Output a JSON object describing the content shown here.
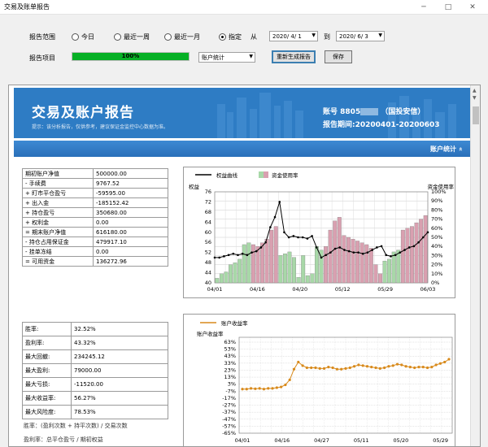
{
  "window": {
    "title": "交易及账单报告",
    "min_icon": "minimize-icon",
    "max_icon": "maximize-icon",
    "close_icon": "close-icon"
  },
  "controls": {
    "range_label": "报告范围",
    "radio_today": "今日",
    "radio_week": "最近一周",
    "radio_month": "最近一月",
    "radio_custom": "指定",
    "selected_range": "指定",
    "from_label": "从",
    "date_from": "2020/ 4/ 1",
    "to_label": "到",
    "date_to": "2020/ 6/ 3",
    "project_label": "报告项目",
    "progress_text": "100%",
    "progress_value": 1.0,
    "progress_color": "#06b025",
    "item_select": "账户统计",
    "regen_button": "重新生成报告",
    "save_button": "保存"
  },
  "report": {
    "title": "交易及账户报告",
    "subtitle": "提示：该分析报告，仅供参考，建议保证金监控中心数据为准。",
    "account_label": "账号",
    "account_prefix": "8805",
    "account_suffix": "（国投安信）",
    "period_label": "报告期间",
    "period_value": "20200401-20200603",
    "section_title": "账户统计",
    "section_toggle": "«"
  },
  "stats1": [
    {
      "label": "期初账户净值",
      "value": "500000.00"
    },
    {
      "label": "- 手续费",
      "value": "9767.52"
    },
    {
      "label": "+ 盯市平仓盈亏",
      "value": "-59595.00"
    },
    {
      "label": "+ 出入金",
      "value": "-185152.42"
    },
    {
      "label": "+ 持仓盈亏",
      "value": "350680.00"
    },
    {
      "label": "+ 权利金",
      "value": "0.00"
    },
    {
      "label": "= 期末账户净值",
      "value": "616180.00"
    },
    {
      "label": "- 持仓占用保证金",
      "value": "479917.10"
    },
    {
      "label": "- 挂单冻结",
      "value": "0.00"
    },
    {
      "label": "= 可用资金",
      "value": "136272.96"
    }
  ],
  "stats2": [
    {
      "label": "胜率:",
      "value": "32.52%"
    },
    {
      "label": "盈利率:",
      "value": "43.32%"
    },
    {
      "label": "最大回撤:",
      "value": "234245.12"
    },
    {
      "label": "最大盈利:",
      "value": "79000.00"
    },
    {
      "label": "最大亏损:",
      "value": "-11520.00"
    },
    {
      "label": "最大收益率:",
      "value": "56.27%"
    },
    {
      "label": "最大风险度:",
      "value": "78.53%"
    }
  ],
  "notes": {
    "win_rate": "胜率：(盈利次数 + 持平次数) / 交易次数",
    "profit_rate": "盈利率：总平仓盈亏 / 期初权益"
  },
  "chart_data": [
    {
      "type": "bar",
      "legend_line": "权益曲线",
      "legend_bar": "资金使用率",
      "ylabel_left": "权益",
      "ylabel_right": "资金使用率",
      "left_ticks": [
        "76",
        "72",
        "68",
        "64",
        "60",
        "56",
        "52",
        "48",
        "44",
        "40"
      ],
      "right_ticks": [
        "100%",
        "90%",
        "80%",
        "70%",
        "60%",
        "50%",
        "40%",
        "30%",
        "20%",
        "10%",
        "0%"
      ],
      "x_ticks": [
        "04/01",
        "04/16",
        "04/20",
        "05/12",
        "05/29",
        "06/03"
      ],
      "ylim_left": [
        40,
        76
      ],
      "ylim_right": [
        0,
        100
      ],
      "bar_colors": {
        "green": "#a8d8a8",
        "pink": "#d9a0b0"
      },
      "usage": [
        {
          "v": 5,
          "c": "green"
        },
        {
          "v": 10,
          "c": "green"
        },
        {
          "v": 12,
          "c": "green"
        },
        {
          "v": 20,
          "c": "green"
        },
        {
          "v": 22,
          "c": "green"
        },
        {
          "v": 26,
          "c": "green"
        },
        {
          "v": 42,
          "c": "green"
        },
        {
          "v": 44,
          "c": "green"
        },
        {
          "v": 42,
          "c": "pink"
        },
        {
          "v": 40,
          "c": "pink"
        },
        {
          "v": 44,
          "c": "pink"
        },
        {
          "v": 48,
          "c": "pink"
        },
        {
          "v": 58,
          "c": "pink"
        },
        {
          "v": 62,
          "c": "pink"
        },
        {
          "v": 30,
          "c": "green"
        },
        {
          "v": 32,
          "c": "green"
        },
        {
          "v": 34,
          "c": "green"
        },
        {
          "v": 28,
          "c": "green"
        },
        {
          "v": 6,
          "c": "green"
        },
        {
          "v": 30,
          "c": "green"
        },
        {
          "v": 8,
          "c": "green"
        },
        {
          "v": 10,
          "c": "green"
        },
        {
          "v": 40,
          "c": "green"
        },
        {
          "v": 36,
          "c": "green"
        },
        {
          "v": 40,
          "c": "pink"
        },
        {
          "v": 58,
          "c": "pink"
        },
        {
          "v": 68,
          "c": "pink"
        },
        {
          "v": 72,
          "c": "pink"
        },
        {
          "v": 52,
          "c": "pink"
        },
        {
          "v": 50,
          "c": "pink"
        },
        {
          "v": 48,
          "c": "pink"
        },
        {
          "v": 46,
          "c": "pink"
        },
        {
          "v": 44,
          "c": "pink"
        },
        {
          "v": 42,
          "c": "pink"
        },
        {
          "v": 38,
          "c": "pink"
        },
        {
          "v": 20,
          "c": "pink"
        },
        {
          "v": 10,
          "c": "pink"
        },
        {
          "v": 24,
          "c": "green"
        },
        {
          "v": 26,
          "c": "green"
        },
        {
          "v": 34,
          "c": "green"
        },
        {
          "v": 36,
          "c": "green"
        },
        {
          "v": 58,
          "c": "pink"
        },
        {
          "v": 60,
          "c": "pink"
        },
        {
          "v": 62,
          "c": "pink"
        },
        {
          "v": 66,
          "c": "pink"
        },
        {
          "v": 70,
          "c": "pink"
        },
        {
          "v": 74,
          "c": "pink"
        }
      ],
      "equity": [
        50,
        50,
        50.5,
        51,
        51.5,
        51,
        51.5,
        51,
        52,
        52.5,
        54,
        56,
        62,
        66,
        72,
        60,
        58,
        58.5,
        58,
        58,
        57.5,
        58.5,
        54,
        50,
        51,
        52,
        53.5,
        54,
        53,
        52.5,
        52,
        52,
        51.5,
        52,
        53,
        54,
        54.5,
        51,
        50.5,
        51,
        52,
        53,
        54,
        54.5,
        56,
        58,
        60
      ]
    },
    {
      "type": "line",
      "legend": "账户收益率",
      "ylabel": "账户收益率",
      "y_ticks": [
        "63%",
        "53%",
        "43%",
        "33%",
        "23%",
        "13%",
        "3%",
        "-7%",
        "-17%",
        "-27%",
        "-37%",
        "-47%",
        "-57%",
        "-65%"
      ],
      "x_ticks": [
        "04/01",
        "04/16",
        "04/27",
        "05/11",
        "05/20",
        "05/29"
      ],
      "ylim": [
        -65,
        63
      ],
      "line_color": "#d88a1c",
      "values": [
        -3,
        -3,
        -2,
        -2.5,
        -2,
        -3,
        -2,
        -2,
        -1,
        0,
        3,
        10,
        25,
        35,
        30,
        27,
        27,
        27,
        26,
        26,
        28,
        27,
        25,
        25,
        26,
        27,
        29,
        31,
        30,
        29,
        28,
        27,
        26,
        27,
        29,
        30,
        32,
        31,
        29,
        28,
        27,
        28,
        28,
        27,
        28,
        31,
        33,
        35,
        39
      ]
    }
  ]
}
